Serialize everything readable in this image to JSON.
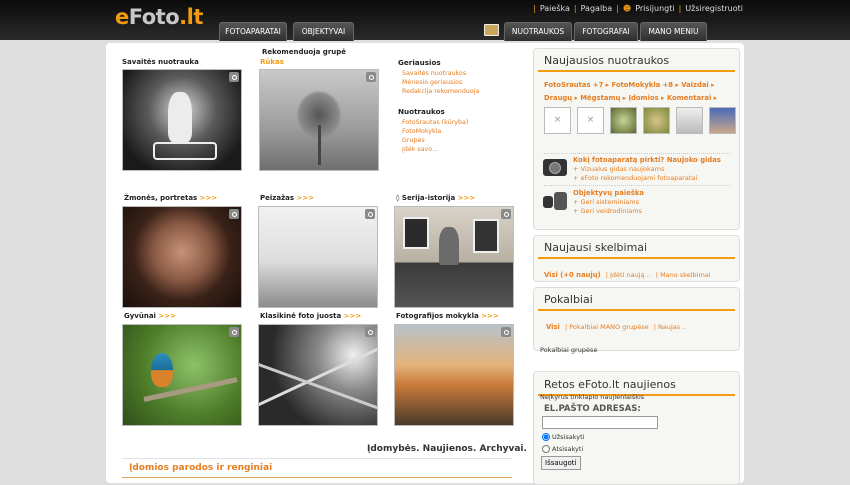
{
  "header": {
    "logo_e": "e",
    "logo_main": "Foto",
    "logo_dom": ".lt",
    "links": [
      "Paieška",
      "Pagalba",
      "Prisijungti",
      "Užsiregistruoti"
    ],
    "tabs_left": [
      "FOTOAPARATAI",
      "OBJEKTYVAI"
    ],
    "tabs_right": [
      "NUOTRAUKOS",
      "FOTOGRAFAI",
      "MANO MENIU"
    ]
  },
  "left": {
    "week_photo_title": "Savaitės nuotrauka",
    "group_title": "Rekomenduoja grupė",
    "group_name": "Rūkas",
    "best": {
      "title": "Geriausios",
      "links": [
        "Savaitės nuotraukos",
        "Mėnesio geriausios",
        "Redakcija rekomenduoja"
      ]
    },
    "photos": {
      "title": "Nuotraukos",
      "links": [
        "FotoSrautas (kūryba)",
        "FotoMokykla",
        "Grupės",
        "Įdėk savo..."
      ]
    },
    "categories": [
      {
        "label": "Žmonės, portretas",
        "arrow": ">>>"
      },
      {
        "label": "Peizažas",
        "arrow": ">>>"
      },
      {
        "label": "◊ Serija-istorija",
        "arrow": ">>>"
      },
      {
        "label": "Gyvūnai",
        "arrow": ">>>"
      },
      {
        "label": "Klasikinė foto juosta",
        "arrow": ">>>"
      },
      {
        "label": "Fotografijos mokykla",
        "arrow": ">>>"
      }
    ],
    "bottom_heading": "Įdomybės. Naujienos. Archyvai.",
    "events_heading": "Įdomios parodos ir renginiai"
  },
  "right": {
    "newest": {
      "title": "Naujausios nuotraukos",
      "links_row1": [
        "FotoSrautas +7",
        "FotoMokykla +8",
        "Vaizdai"
      ],
      "links_row2": [
        "Draugų",
        "Mėgstamų",
        "Įdomios",
        "Komentarai"
      ],
      "camera_link": "Kokį fotoaparatą pirkti? Naujoko gidas",
      "camera_sub1": "+ Vizualus gidas naujokams",
      "camera_sub2": "+ eFoto rekomenduojami fotoaparatai",
      "lens_link": "Objektyvų paieška",
      "lens_sub1": "+ Geri sisteminiams",
      "lens_sub2": "+ Geri veidrodiniams"
    },
    "ads": {
      "title": "Naujausi skelbimai",
      "links": [
        "Visi (+0 naujų)",
        "Įdėti naują ..",
        "Mano skelbimai"
      ]
    },
    "chats": {
      "title": "Pokalbiai",
      "links": [
        "Visi",
        "Pokalbiai MANO grupėse",
        "Naujas .."
      ],
      "sub": "Pokalbiai grupėse"
    },
    "news": {
      "title": "Retos eFoto.lt naujienos",
      "desc": "Neįkyrus tinklapio naujienlaiškis",
      "email_label": "EL.PAŠTO ADRESAS:",
      "email_value": "",
      "subscribe": "Užsisakyti",
      "unsubscribe": "Atsisakyti",
      "save": "Išsaugoti"
    }
  },
  "colors": {
    "accent": "#f39c12",
    "link": "#e67e22",
    "topbar": "#1a1a1a"
  }
}
